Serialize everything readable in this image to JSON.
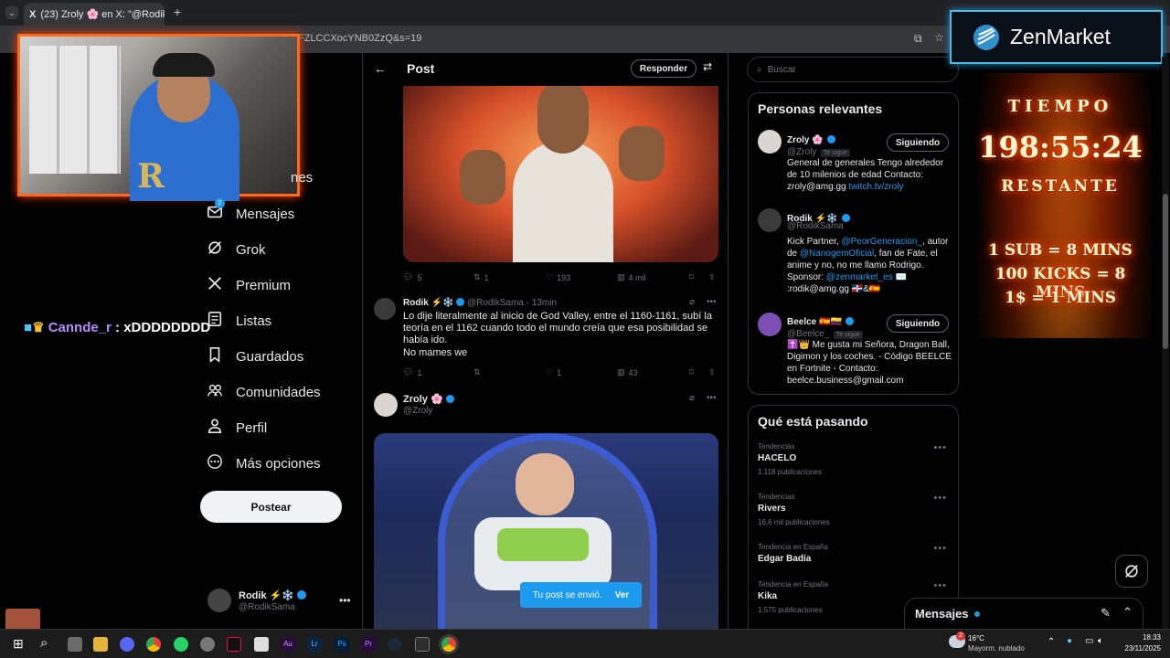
{
  "browser": {
    "tab_title": "(23) Zroly 🌸 en X: \"@RodikSa",
    "url": "FZLCCXocYNB0ZzQ&s=19"
  },
  "sidebar": {
    "partial_label": "nes",
    "items": [
      {
        "label": "Mensajes",
        "icon": "envelope-icon",
        "badge": "2"
      },
      {
        "label": "Grok",
        "icon": "grok-icon"
      },
      {
        "label": "Premium",
        "icon": "x-logo-icon"
      },
      {
        "label": "Listas",
        "icon": "list-icon"
      },
      {
        "label": "Guardados",
        "icon": "bookmark-icon"
      },
      {
        "label": "Comunidades",
        "icon": "people-icon"
      },
      {
        "label": "Perfil",
        "icon": "person-icon"
      },
      {
        "label": "Más opciones",
        "icon": "more-circle-icon"
      }
    ],
    "post_button": "Postear",
    "account": {
      "name": "Rodik ⚡❄️",
      "handle": "@RodikSama"
    }
  },
  "center": {
    "header_title": "Post",
    "reply_button": "Responder",
    "first_actions": {
      "replies": "5",
      "reposts": "1",
      "likes": "193",
      "views": "4 mil"
    },
    "reply_tweet": {
      "name": "Rodik ⚡❄️",
      "handle": "@RodikSama",
      "time": "· 13min",
      "text": "Lo dije literalmente al inicio de God Valley, entre el 1160-1161, subí la teoría en el 1162 cuando todo el mundo creía que esa posibilidad se había ido.",
      "text2": "No mames we",
      "actions": {
        "replies": "1",
        "reposts": "",
        "likes": "1",
        "views": "43"
      }
    },
    "compose": {
      "name": "Zroly 🌸",
      "handle": "@Zroly"
    },
    "toast": {
      "text": "Tu post se envió.",
      "action": "Ver"
    }
  },
  "right": {
    "search_placeholder": "Buscar",
    "relevant_title": "Personas relevantes",
    "people": [
      {
        "name": "Zroly 🌸",
        "handle": "@Zroly",
        "tag": "Te sigue",
        "button": "Siguiendo",
        "bio": "General de generales Tengo alrededor de 10 milenios de edad Contacto: zroly@amg.gg ",
        "bio_link": "twitch.tv/zroly"
      },
      {
        "name": "Rodik ⚡❄️",
        "handle": "@RodikSama",
        "bio_parts": [
          "Kick Partner, ",
          "@PeorGeneracion_",
          ", autor de ",
          "@NanogemOficial",
          ", fan de Fate, el anime y no, no me llamo Rodrigo. Sponsor: ",
          "@zenmarket_es",
          " ✉️ :rodik@amg.gg 🇩🇴&🇪🇸"
        ]
      },
      {
        "name": "Beelce 🇪🇸🇨🇴",
        "handle": "@Beelce_",
        "tag": "Te sigue",
        "button": "Siguiendo",
        "bio": "✝️👑 Me gusta mi Señora, Dragon Ball, Digimon y los coches. - Código BEELCE en Fortnite - Contacto: beelce.business@gmail.com"
      }
    ],
    "trends_title": "Qué está pasando",
    "trends": [
      {
        "meta": "Tendencias",
        "name": "HACELO",
        "count": "1.118 publicaciones"
      },
      {
        "meta": "Tendencias",
        "name": "Rivers",
        "count": "16,6 mil publicaciones"
      },
      {
        "meta": "Tendencia en España",
        "name": "Edgar Badía",
        "count": ""
      },
      {
        "meta": "Tendencia en España",
        "name": "Kika",
        "count": "1.575 publicaciones"
      }
    ],
    "messages_drawer": "Mensajes"
  },
  "overlay": {
    "chat_user": "Cannde_r",
    "chat_message": ": xDDDDDDDD",
    "sponsor": "ZenMarket",
    "timer_label": "TIEMPO",
    "timer_value": "198:55:24",
    "timer_sub": "RESTANTE",
    "rules": [
      "1 SUB = 8 MINS",
      "100 KICKS = 8 MINS",
      "1$ = 1 MINS"
    ]
  },
  "taskbar": {
    "weather_temp": "16°C",
    "weather_desc": "Mayorm. nublado",
    "weather_badge": "2",
    "time": "18:33",
    "date": "23/11/2025"
  },
  "colors": {
    "accent": "#1d9bf0",
    "zen_border": "#4db7e8"
  }
}
